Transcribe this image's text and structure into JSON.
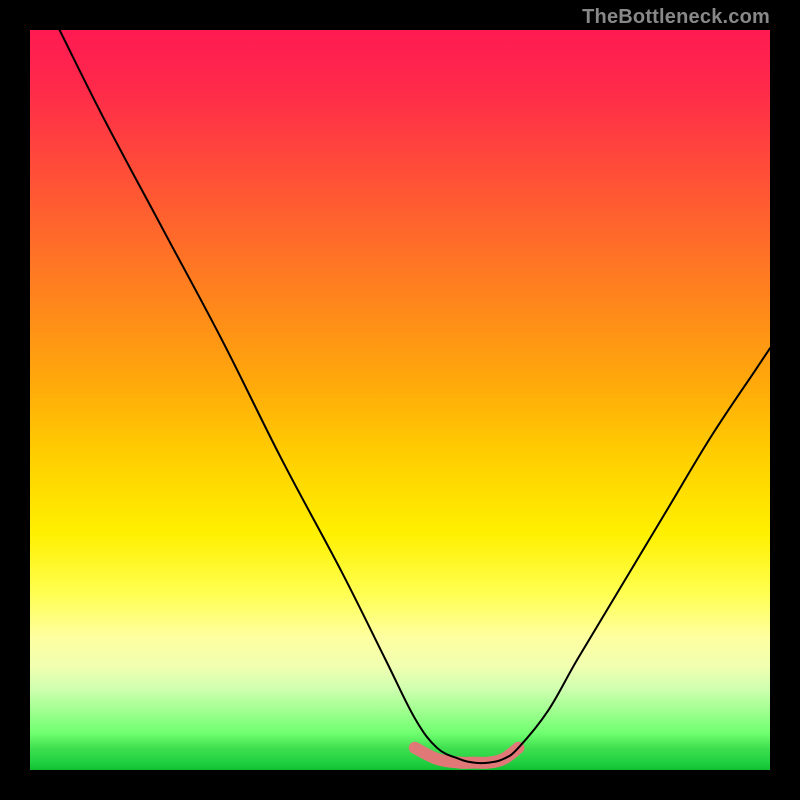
{
  "watermark": "TheBottleneck.com",
  "chart_data": {
    "type": "line",
    "title": "",
    "xlabel": "",
    "ylabel": "",
    "xlim": [
      0,
      100
    ],
    "ylim": [
      0,
      100
    ],
    "grid": false,
    "legend": false,
    "background_gradient": {
      "stops": [
        {
          "pos": 0,
          "color": "#ff1a52"
        },
        {
          "pos": 0.5,
          "color": "#ffd000"
        },
        {
          "pos": 0.85,
          "color": "#ffff80"
        },
        {
          "pos": 1,
          "color": "#10c030"
        }
      ]
    },
    "series": [
      {
        "name": "bottleneck-curve",
        "color": "#000000",
        "stroke_width": 2,
        "x": [
          4,
          10,
          18,
          26,
          34,
          42,
          48,
          52,
          55,
          58,
          60,
          62,
          64,
          66,
          70,
          74,
          80,
          86,
          92,
          98,
          100
        ],
        "values": [
          100,
          88,
          73,
          58,
          42,
          27,
          15,
          7,
          3,
          1.5,
          1,
          1,
          1.5,
          3,
          8,
          15,
          25,
          35,
          45,
          54,
          57
        ]
      },
      {
        "name": "accent-band",
        "color": "#e07878",
        "stroke_width": 12,
        "x": [
          52,
          55,
          58,
          60,
          62,
          64,
          66
        ],
        "values": [
          3,
          1.5,
          1,
          1,
          1,
          1.5,
          3
        ]
      }
    ]
  }
}
